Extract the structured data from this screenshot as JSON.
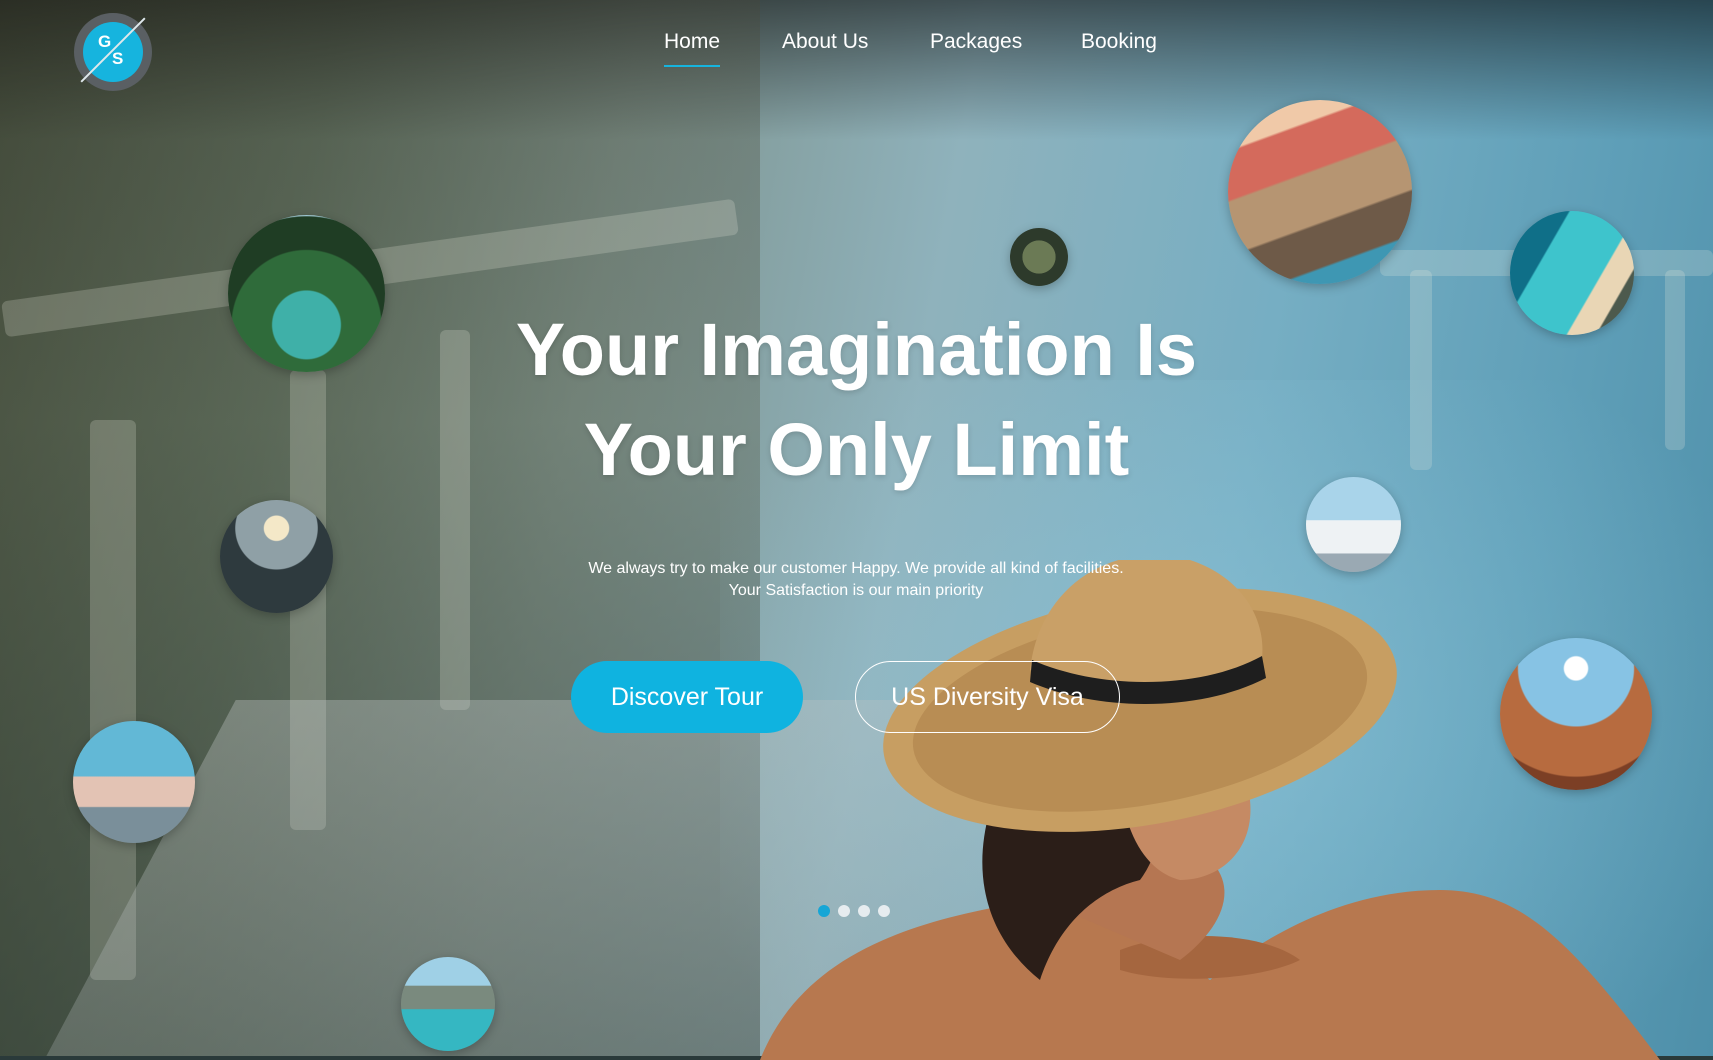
{
  "brand": {
    "logo_top": "G",
    "logo_bottom": "S"
  },
  "nav": {
    "items": [
      "Home",
      "About Us",
      "Packages",
      "Booking"
    ],
    "active": "Home"
  },
  "hero": {
    "headline_line1": "Your Imagination Is",
    "headline_line2": "Your Only Limit",
    "subtitle_line1": "We always try to make our customer Happy. We provide all kind of facilities.",
    "subtitle_line2": "Your Satisfaction is our main priority",
    "primary_button": "Discover Tour",
    "secondary_button": "US Diversity Visa"
  },
  "carousel": {
    "slide_count": 4,
    "active_index": 0
  },
  "colors": {
    "accent": "#0fb3e0",
    "text": "#ffffff"
  }
}
